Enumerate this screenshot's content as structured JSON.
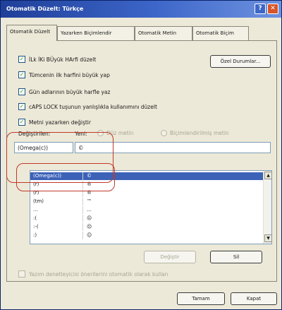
{
  "window": {
    "title": "Otomatik Düzelt: Türkçe",
    "help_glyph": "?",
    "close_glyph": "✕"
  },
  "tabs": [
    {
      "label": "Otomatik Düzelt",
      "active": true
    },
    {
      "label": "Yazarken Biçimlendir",
      "active": false
    },
    {
      "label": "Otomatik Metin",
      "active": false
    },
    {
      "label": "Otomatik Biçim",
      "active": false
    }
  ],
  "options": {
    "exceptions_button": "Özel Durumlar...",
    "checkboxes": [
      {
        "label": "İLk İKi BÜyük HArfi düzelt",
        "checked": true
      },
      {
        "label": "Tümcenin ilk harfini büyük yap",
        "checked": true
      },
      {
        "label": "Gün adlarının büyük harfle yaz",
        "checked": true
      },
      {
        "label": "cAPS LOCK tuşunun yanlışlıkla kullanımını düzelt",
        "checked": true
      },
      {
        "label": "Metni yazarken değiştir",
        "checked": true
      }
    ]
  },
  "replace": {
    "replace_label": "Değiştirilen:",
    "with_label": "Yeni:",
    "plain_text_radio": "Düz metin",
    "formatted_text_radio": "Biçimlendirilmiş metin",
    "replace_value": "(Omega(c))",
    "with_value": "©"
  },
  "entries": [
    {
      "from": "(Omega(c))",
      "to": "©",
      "selected": true
    },
    {
      "from": "(r)",
      "to": "®",
      "selected": false
    },
    {
      "from": "(r)",
      "to": "®",
      "selected": false
    },
    {
      "from": "(tm)",
      "to": "™",
      "selected": false
    },
    {
      "from": "...",
      "to": "…",
      "selected": false
    },
    {
      "from": ":(",
      "to": "☹",
      "selected": false
    },
    {
      "from": ":-(",
      "to": "☹",
      "selected": false
    },
    {
      "from": ":)",
      "to": "☺",
      "selected": false
    }
  ],
  "actions": {
    "replace_button": "Değiştir",
    "delete_button": "Sil"
  },
  "footer": {
    "spell_checker_label": "Yazım denetleyicisi önerilerini otomatik olarak kullan",
    "ok_button": "Tamam",
    "cancel_button": "Kapat"
  },
  "colors": {
    "title_bar": "#2a4ea8",
    "selection": "#3c62b8",
    "annotation": "#c0392b"
  },
  "icons": {
    "check": "checkmark-icon",
    "scroll_up": "scroll-up-arrow-icon",
    "scroll_down": "scroll-down-arrow-icon"
  }
}
